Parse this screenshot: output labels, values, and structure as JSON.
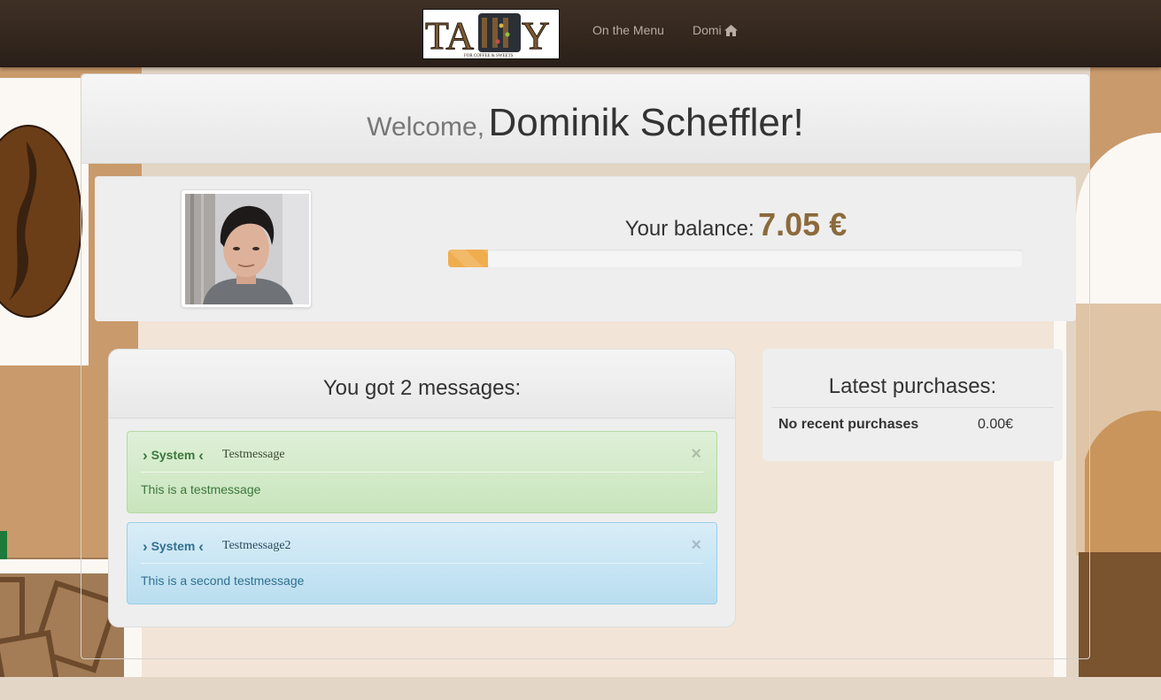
{
  "navbar": {
    "brand": {
      "wordmark": "TALLY",
      "tagline": "For Coffee & Sweets"
    },
    "links": {
      "menu": "On the Menu",
      "user": "Domi"
    },
    "icons": {
      "user_home": "home-icon"
    }
  },
  "header": {
    "welcome_prefix": "Welcome,",
    "user_name": "Dominik Scheffler!"
  },
  "profile": {
    "avatar": "avatar-photo",
    "balance_label": "Your balance:",
    "balance_value": "7.05 €",
    "balance_progress_percent": 7,
    "progress_color": "#f0ad4e"
  },
  "messages": {
    "title": "You got 2 messages:",
    "items": [
      {
        "sender": "System",
        "subject": "Testmessage",
        "body": "This is a testmessage",
        "style": "success",
        "close_label": "×"
      },
      {
        "sender": "System",
        "subject": "Testmessage2",
        "body": "This is a second testmessage",
        "style": "info",
        "close_label": "×"
      }
    ]
  },
  "purchases": {
    "title": "Latest purchases:",
    "rows": [
      {
        "item": "No recent purchases",
        "price": "0.00€"
      }
    ]
  },
  "colors": {
    "navbar": "#2f241b",
    "balance_value": "#8c6a3c",
    "background_tan": "#c99a6b",
    "background_light": "#f0e4d8"
  }
}
